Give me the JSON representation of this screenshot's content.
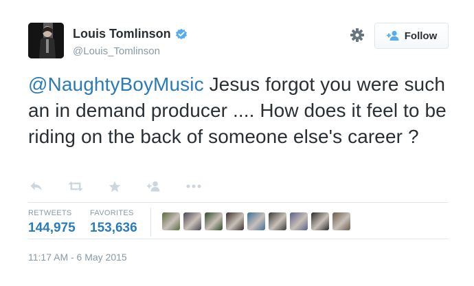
{
  "author": {
    "name": "Louis Tomlinson",
    "handle": "@Louis_Tomlinson",
    "verified": true
  },
  "follow_button": {
    "label": "Follow",
    "icon": "add-user-icon"
  },
  "settings_icon": "gear-icon",
  "tweet": {
    "mention": "@NaughtyBoyMusic",
    "text": " Jesus forgot you were such an in demand producer .... How does it feel to be riding on the back of someone else's career ?"
  },
  "actions": [
    "reply-icon",
    "retweet-icon",
    "favorite-icon",
    "follow-icon",
    "more-icon"
  ],
  "stats": {
    "retweets_label": "RETWEETS",
    "retweets_value": "144,975",
    "favorites_label": "FAVORITES",
    "favorites_value": "153,636"
  },
  "favorited_by_avatars": [
    {
      "color": "#5a6b3e"
    },
    {
      "color": "#4a4658"
    },
    {
      "color": "#2f4a2a"
    },
    {
      "color": "#3b2f2b"
    },
    {
      "color": "#3d6f9a"
    },
    {
      "color": "#3a3a3a"
    },
    {
      "color": "#5b5f8a"
    },
    {
      "color": "#2a2a2a"
    },
    {
      "color": "#6a5a4a"
    }
  ],
  "timestamp": "11:17 AM - 6 May 2015",
  "colors": {
    "link": "#2b7bb9",
    "muted": "#8899a6",
    "text": "#292f33",
    "verified": "#55acee",
    "border": "#e1e8ed"
  }
}
